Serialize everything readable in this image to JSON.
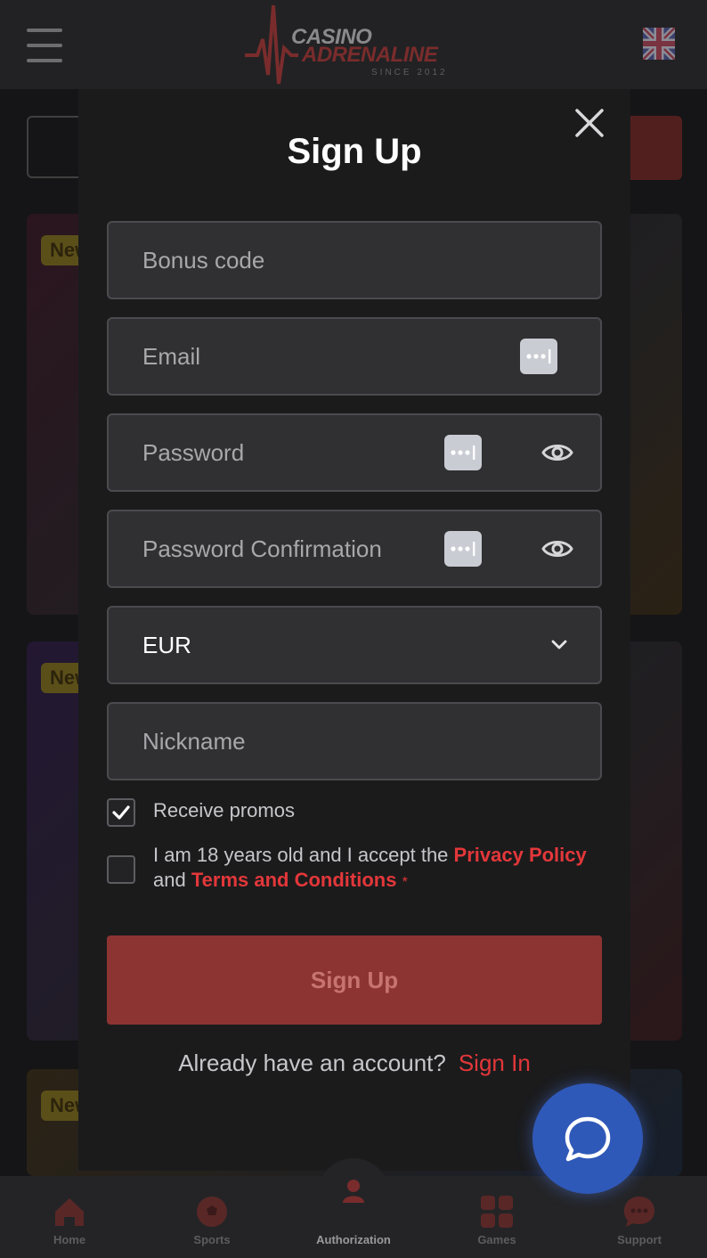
{
  "header": {
    "logo_line1": "CASINO",
    "logo_line2": "ADRENALINE",
    "logo_tagline": "SINCE 2012",
    "language_icon": "uk-flag-icon"
  },
  "background": {
    "badges": [
      "New",
      "New",
      "New"
    ]
  },
  "modal": {
    "title": "Sign Up",
    "fields": {
      "bonus_code_placeholder": "Bonus code",
      "email_placeholder": "Email",
      "password_placeholder": "Password",
      "password_confirmation_placeholder": "Password Confirmation",
      "currency_value": "EUR",
      "nickname_placeholder": "Nickname"
    },
    "receive_promos": {
      "label": "Receive promos",
      "checked": true
    },
    "terms": {
      "text_before": "I am 18 years old and I accept the",
      "privacy_link": "Privacy Policy",
      "text_and": "and",
      "terms_link": "Terms and Conditions",
      "required_mark": "*",
      "checked": false
    },
    "submit_label": "Sign Up",
    "account_prompt": "Already have an account?",
    "signin_link": "Sign In"
  },
  "bottom_nav": {
    "items": [
      {
        "label": "Home",
        "icon": "home-icon"
      },
      {
        "label": "Sports",
        "icon": "soccer-ball-icon"
      },
      {
        "label": "Authorization",
        "icon": "user-icon"
      },
      {
        "label": "Games",
        "icon": "grid-icon"
      },
      {
        "label": "Support",
        "icon": "chat-icon"
      }
    ]
  },
  "colors": {
    "accent_red": "#e3373a",
    "button_red": "#8c3432",
    "chat_blue": "#2f59b8"
  }
}
